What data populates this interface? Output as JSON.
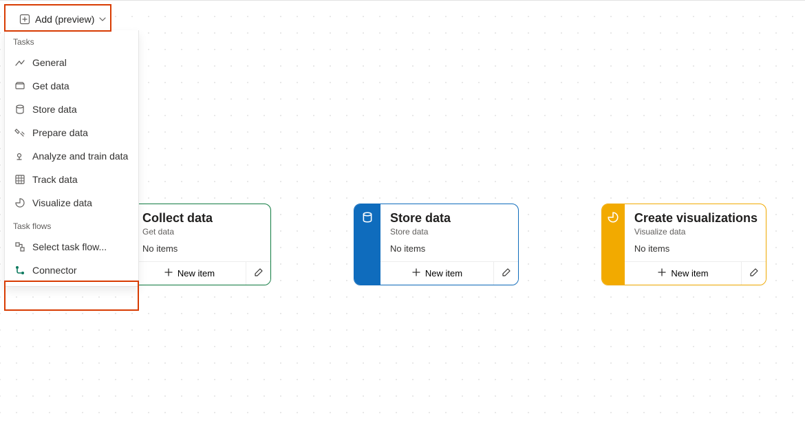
{
  "add_button_label": "Add (preview)",
  "dropdown": {
    "section_tasks": "Tasks",
    "section_taskflows": "Task flows",
    "items": {
      "general": "General",
      "get_data": "Get data",
      "store_data": "Store data",
      "prepare_data": "Prepare data",
      "analyze": "Analyze and train data",
      "track_data": "Track data",
      "visualize": "Visualize data",
      "select_task_flow": "Select task flow...",
      "connector": "Connector"
    }
  },
  "cards": {
    "collect": {
      "title": "Collect data",
      "subtitle": "Get data",
      "status": "No items",
      "new_item": "New item"
    },
    "store": {
      "title": "Store data",
      "subtitle": "Store data",
      "status": "No items",
      "new_item": "New item"
    },
    "visualize": {
      "title": "Create visualizations",
      "subtitle": "Visualize data",
      "status": "No items",
      "new_item": "New item"
    }
  }
}
